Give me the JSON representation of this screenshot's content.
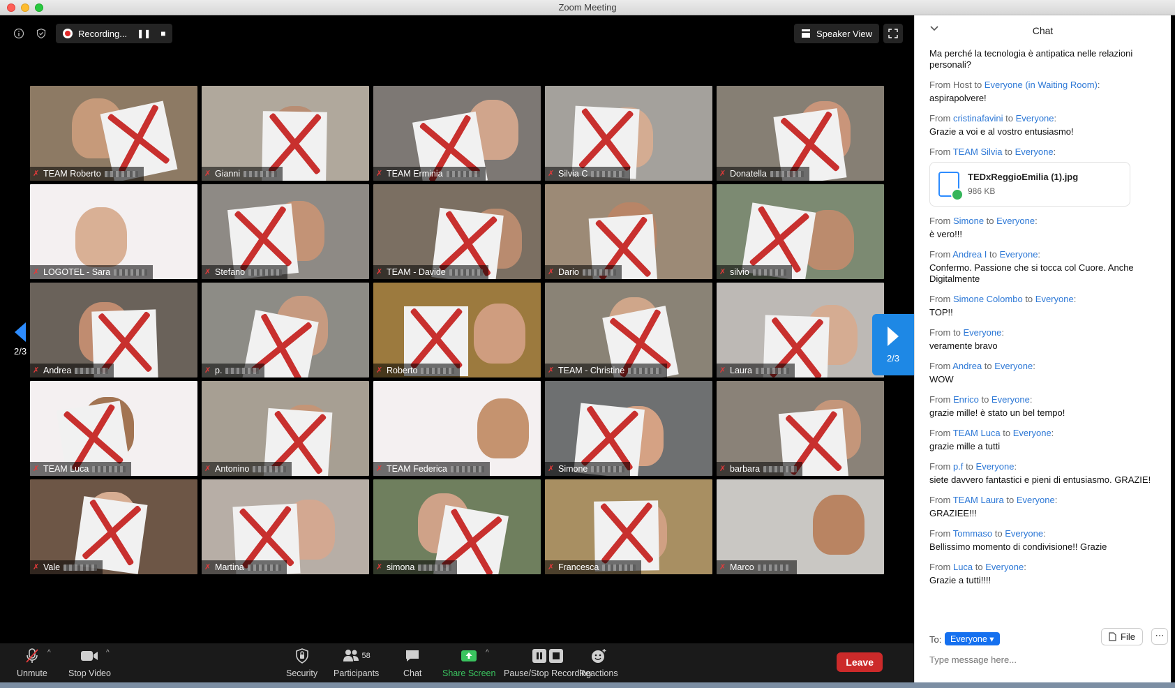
{
  "window": {
    "title": "Zoom Meeting"
  },
  "topbar": {
    "recording_label": "Recording...",
    "speaker_view_label": "Speaker View"
  },
  "pagination": {
    "prev": "2/3",
    "next": "2/3"
  },
  "participants": [
    {
      "name": "TEAM Roberto",
      "bg": "#8d7a64",
      "skin": "#c69a7a",
      "paper": true
    },
    {
      "name": "Gianni",
      "bg": "#b0a89c",
      "skin": "#b88d73",
      "paper": true
    },
    {
      "name": "TEAM Erminia",
      "bg": "#7d7874",
      "skin": "#d0a58c",
      "paper": true
    },
    {
      "name": "Silvia C",
      "bg": "#a4a19c",
      "skin": "#d4ac92",
      "paper": true
    },
    {
      "name": "Donatella",
      "bg": "#867f74",
      "skin": "#c9957a",
      "paper": true
    },
    {
      "name": "LOGOTEL - Sara",
      "bg": "#f4f0f1",
      "skin": "#d9b095",
      "paper": false
    },
    {
      "name": "Stefano",
      "bg": "#8e8a85",
      "skin": "#c39376",
      "paper": true
    },
    {
      "name": "TEAM - Davide",
      "bg": "#7b6f62",
      "skin": "#b98b6f",
      "paper": true
    },
    {
      "name": "Dario",
      "bg": "#9c8a76",
      "skin": "#b88567",
      "paper": true
    },
    {
      "name": "silvio",
      "bg": "#7c8a72",
      "skin": "#bb8b6d",
      "paper": true
    },
    {
      "name": "Andrea",
      "bg": "#6a625a",
      "skin": "#c08c70",
      "paper": true
    },
    {
      "name": "p.",
      "bg": "#8d8c86",
      "skin": "#c69a80",
      "paper": true
    },
    {
      "name": "Roberto",
      "bg": "#9c7a3e",
      "skin": "#cf9d7f",
      "paper": true
    },
    {
      "name": "TEAM - Christine",
      "bg": "#8a8376",
      "skin": "#cfa68a",
      "paper": true
    },
    {
      "name": "Laura",
      "bg": "#bdb9b5",
      "skin": "#d5ac92",
      "paper": true
    },
    {
      "name": "TEAM Luca",
      "bg": "#f4f0f1",
      "skin": "#a27452",
      "paper": true
    },
    {
      "name": "Antonino",
      "bg": "#a79f93",
      "skin": "#c49577",
      "paper": true
    },
    {
      "name": "TEAM Federica",
      "bg": "#f4f0f1",
      "skin": "#c5936f",
      "paper": false
    },
    {
      "name": "Simone",
      "bg": "#6e7071",
      "skin": "#d5a284",
      "paper": true
    },
    {
      "name": "barbara",
      "bg": "#8a8278",
      "skin": "#c4967a",
      "paper": true
    },
    {
      "name": "Vale",
      "bg": "#6d5646",
      "skin": "#d7ad92",
      "paper": true
    },
    {
      "name": "Martina",
      "bg": "#b7aea6",
      "skin": "#d3a891",
      "paper": true
    },
    {
      "name": "simona",
      "bg": "#6f7f5e",
      "skin": "#cfa288",
      "paper": true
    },
    {
      "name": "Francesca",
      "bg": "#a88f62",
      "skin": "#d0a083",
      "paper": true
    },
    {
      "name": "Marco",
      "bg": "#c9c7c3",
      "skin": "#b98462",
      "paper": false
    }
  ],
  "toolbar": {
    "unmute": "Unmute",
    "stop_video": "Stop Video",
    "security": "Security",
    "participants": "Participants",
    "participant_count": "58",
    "chat": "Chat",
    "share_screen": "Share Screen",
    "pause_stop_recording": "Pause/Stop Recording",
    "reactions": "Reactions",
    "leave": "Leave"
  },
  "chat": {
    "title": "Chat",
    "first_message": "Ma perché la tecnologia è antipatica nelle relazioni personali?",
    "messages": [
      {
        "from": "Host",
        "to": "Everyone (in Waiting Room)",
        "text": "aspirapolvere!"
      },
      {
        "from": "cristinafavini",
        "to": "Everyone",
        "text": "Grazie a voi e al vostro entusiasmo!"
      },
      {
        "from": "TEAM Silvia",
        "to": "Everyone",
        "text": ""
      },
      {
        "from": "Simone",
        "to": "Everyone",
        "text": "è vero!!!"
      },
      {
        "from": "Andrea I",
        "to": "Everyone",
        "text": "Confermo. Passione che si tocca col Cuore. Anche Digitalmente"
      },
      {
        "from": "Simone Colombo",
        "to": "Everyone",
        "text": "TOP!!"
      },
      {
        "from": "",
        "to": "Everyone",
        "text": "veramente bravo"
      },
      {
        "from": "Andrea",
        "to": "Everyone",
        "text": "WOW"
      },
      {
        "from": "Enrico",
        "to": "Everyone",
        "text": "grazie mille! è stato un bel tempo!"
      },
      {
        "from": "TEAM Luca",
        "to": "Everyone",
        "text": "grazie mille a tutti"
      },
      {
        "from": "p.f",
        "to": "Everyone",
        "text": "siete davvero fantastici e pieni di entusiasmo. GRAZIE!"
      },
      {
        "from": "TEAM Laura",
        "to": "Everyone",
        "text": "GRAZIEE!!!"
      },
      {
        "from": "Tommaso",
        "to": "Everyone",
        "text": "Bellissimo momento di condivisione!! Grazie"
      },
      {
        "from": "Luca",
        "to": "Everyone",
        "text": "Grazie a tutti!!!!"
      }
    ],
    "file": {
      "name": "TEDxReggioEmilia (1).jpg",
      "size": "986 KB"
    },
    "from_word": "From",
    "to_word": "to",
    "to_label": "To:",
    "to_select": "Everyone",
    "file_button": "File",
    "input_placeholder": "Type message here..."
  }
}
